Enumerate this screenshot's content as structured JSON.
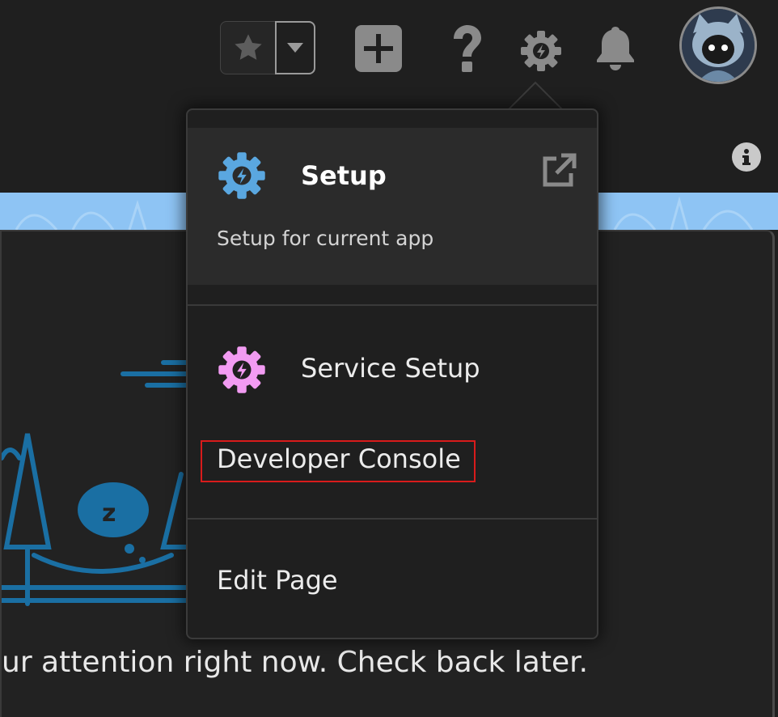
{
  "header": {
    "favorites_star_icon": "star-icon",
    "favorites_dropdown_icon": "chevron-down-icon",
    "global_actions_icon": "plus-icon",
    "help_icon": "question-icon",
    "setup_icon": "gear-icon",
    "notifications_icon": "bell-icon",
    "avatar_icon": "user-avatar-icon",
    "info_icon": "info-icon"
  },
  "setup_menu": {
    "setup": {
      "title": "Setup",
      "subtitle": "Setup for current app",
      "icon": "setup-gear-icon",
      "external_icon": "open-new-window-icon",
      "icon_color": "#5aa7e0"
    },
    "items": [
      {
        "label": "Service Setup",
        "icon": "service-setup-gear-icon",
        "icon_color": "#f29bf2"
      },
      {
        "label": "Developer Console"
      },
      {
        "label": "Edit Page"
      }
    ],
    "highlight_color": "#d81b1b"
  },
  "main": {
    "empty_message": "ur attention right now. Check back later."
  },
  "colors": {
    "background": "#1f1f1f",
    "banner": "#8ec4f4",
    "illustration": "#1a6fa3"
  }
}
